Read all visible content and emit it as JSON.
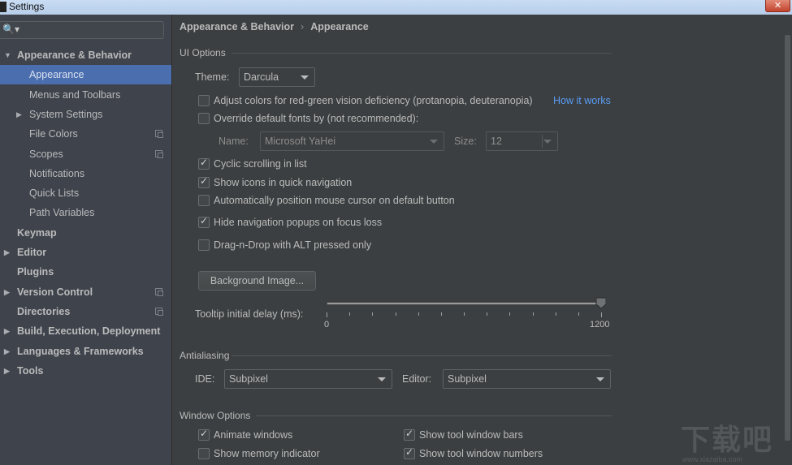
{
  "window": {
    "title": "Settings",
    "close_glyph": "✕"
  },
  "sidebar": {
    "search_placeholder": "",
    "search_icon": "🔍▾",
    "items": [
      {
        "label": "Appearance & Behavior",
        "level": 0,
        "bold": true,
        "expanded": true,
        "arrow": "▼"
      },
      {
        "label": "Appearance",
        "level": 1,
        "selected": true
      },
      {
        "label": "Menus and Toolbars",
        "level": 1
      },
      {
        "label": "System Settings",
        "level": 1,
        "arrow": "▶"
      },
      {
        "label": "File Colors",
        "level": 1,
        "project_icon": true
      },
      {
        "label": "Scopes",
        "level": 1,
        "project_icon": true
      },
      {
        "label": "Notifications",
        "level": 1
      },
      {
        "label": "Quick Lists",
        "level": 1
      },
      {
        "label": "Path Variables",
        "level": 1
      },
      {
        "label": "Keymap",
        "level": 0,
        "bold": true
      },
      {
        "label": "Editor",
        "level": 0,
        "bold": true,
        "arrow": "▶"
      },
      {
        "label": "Plugins",
        "level": 0,
        "bold": true
      },
      {
        "label": "Version Control",
        "level": 0,
        "bold": true,
        "arrow": "▶",
        "project_icon": true
      },
      {
        "label": "Directories",
        "level": 0,
        "bold": true,
        "project_icon": true
      },
      {
        "label": "Build, Execution, Deployment",
        "level": 0,
        "bold": true,
        "arrow": "▶"
      },
      {
        "label": "Languages & Frameworks",
        "level": 0,
        "bold": true,
        "arrow": "▶"
      },
      {
        "label": "Tools",
        "level": 0,
        "bold": true,
        "arrow": "▶"
      }
    ]
  },
  "breadcrumb": {
    "parent": "Appearance & Behavior",
    "separator": "›",
    "current": "Appearance"
  },
  "ui_options": {
    "title": "UI Options",
    "theme_label": "Theme:",
    "theme_value": "Darcula",
    "color_deficiency": {
      "label": "Adjust colors for red-green vision deficiency (protanopia, deuteranopia)",
      "checked": false,
      "link": "How it works"
    },
    "override_fonts": {
      "label": "Override default fonts by (not recommended):",
      "checked": false
    },
    "font_name_label": "Name:",
    "font_name_value": "Microsoft YaHei",
    "font_size_label": "Size:",
    "font_size_value": "12",
    "checkboxes": [
      {
        "label": "Cyclic scrolling in list",
        "checked": true
      },
      {
        "label": "Show icons in quick navigation",
        "checked": true
      },
      {
        "label": "Automatically position mouse cursor on default button",
        "checked": false
      },
      {
        "label": "Hide navigation popups on focus loss",
        "checked": true
      },
      {
        "label": "Drag-n-Drop with ALT pressed only",
        "checked": false
      }
    ],
    "background_image_button": "Background Image...",
    "tooltip_delay": {
      "label": "Tooltip initial delay (ms):",
      "min": 0,
      "max": 1200,
      "value": 1200,
      "min_label": "0",
      "max_label": "1200"
    }
  },
  "antialiasing": {
    "title": "Antialiasing",
    "ide_label": "IDE:",
    "ide_value": "Subpixel",
    "editor_label": "Editor:",
    "editor_value": "Subpixel"
  },
  "window_options": {
    "title": "Window Options",
    "checkboxes": [
      {
        "label": "Animate windows",
        "checked": true
      },
      {
        "label": "Show tool window bars",
        "checked": true
      },
      {
        "label": "Show memory indicator",
        "checked": false
      },
      {
        "label": "Show tool window numbers",
        "checked": true
      }
    ]
  },
  "watermark": {
    "text": "下载吧",
    "url": "www.xiazaiba.com"
  },
  "colors": {
    "selection": "#4b6eaf",
    "link": "#589df6",
    "background": "#3c3f41",
    "sidebar": "#3e434c"
  }
}
